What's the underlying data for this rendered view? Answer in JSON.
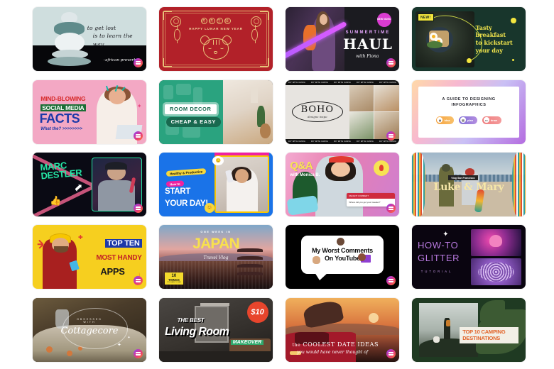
{
  "gallery": {
    "name": "youtube-thumbnail-template-gallery",
    "columns": 4,
    "rows": 5,
    "background": "#ffffff",
    "badge_icon": "canva-badge-icon",
    "cards": [
      {
        "id": "stones-proverb",
        "badge": true,
        "quote_line1": "to get lost",
        "quote_line2": "is to learn the way.",
        "attribution": "–african proverb"
      },
      {
        "id": "lunar-new-year",
        "badge": false,
        "glyphs": [
          "虎",
          "虎",
          "生",
          "威"
        ],
        "subtitle": "HAPPY LUNAR NEW YEAR"
      },
      {
        "id": "summertime-haul",
        "badge": true,
        "kicker": "SUMMERTIME",
        "title": "HAUL",
        "script": "with Fiona",
        "sticker": "NEW VIDEO"
      },
      {
        "id": "tasty-breakfast",
        "badge": false,
        "tag": "NEW!",
        "title_line1": "Tasty",
        "title_line2": "breakfast",
        "title_line3": "to kickstart",
        "title_line4": "your day"
      },
      {
        "id": "mind-blowing-facts",
        "badge": true,
        "line1": "MIND-BLOWING",
        "line2": "SOCIAL MEDIA",
        "line3": "FACTS",
        "line4": "What the? >>>>>>>>"
      },
      {
        "id": "room-decor",
        "badge": false,
        "pill1": "ROOM DECOR",
        "pill2": "CHEAP & EASY"
      },
      {
        "id": "boho",
        "badge": true,
        "strip_text": "DIY WITH CANVA",
        "title": "BOHO",
        "subtitle": "designs inspo"
      },
      {
        "id": "infographics-guide",
        "badge": false,
        "title_line1": "A GUIDE TO DESIGNING",
        "title_line2": "INFOGRAPHICS",
        "pills": [
          {
            "label": "idea",
            "icon": "bulb-icon"
          },
          {
            "label": "plan",
            "icon": "note-icon"
          },
          {
            "label": "draw",
            "icon": "screen-icon"
          }
        ]
      },
      {
        "id": "marc-destler",
        "badge": true,
        "name_line1": "MARC",
        "name_line2": "DESTLER",
        "arrow": "arrow-up-right-icon",
        "thumb": "thumbs-up-icon"
      },
      {
        "id": "start-your-day",
        "badge": false,
        "tag_top": "Healthy & Productive",
        "tag_how": "How to",
        "title_line1": "START",
        "title_line2": "YOUR DAY!"
      },
      {
        "id": "qa-monica",
        "badge": true,
        "title": "Q&A",
        "subtitle": "with Monica B.",
        "comment_header": "RECENT COMMENT",
        "comment_body": "Where did you get your sweater?"
      },
      {
        "id": "luke-and-mary",
        "badge": false,
        "tag": "Vlog San Francisco",
        "title": "Luke & Mary"
      },
      {
        "id": "top-ten-apps",
        "badge": false,
        "line1": "TOP TEN",
        "line2": "MOST HANDY",
        "line3": "APPS",
        "icon": "tap-hand-icon"
      },
      {
        "id": "japan-travel",
        "badge": false,
        "kicker": "ONE WEEK IN",
        "title": "JAPAN",
        "script": "Travel Vlog",
        "badge_num": "10",
        "badge_word": "THINGS",
        "badge_sub": "YOU HAVE TO SEE"
      },
      {
        "id": "worst-comments",
        "badge": true,
        "line1": "My Worst Comments",
        "line2": "On YouTube"
      },
      {
        "id": "how-to-glitter",
        "badge": false,
        "line1": "HOW-TO",
        "line2": "GLITTER",
        "sub": "TUTORIAL",
        "icon": "sparkle-icon"
      },
      {
        "id": "cottagecore",
        "badge": true,
        "kicker_line1": "OBSESSED",
        "kicker_line2": "WITH",
        "title": "Cottagecore"
      },
      {
        "id": "living-room-makeover",
        "badge": false,
        "line1": "THE BEST",
        "price": "$10",
        "line2": "Living Room",
        "line3": "MAKEOVER"
      },
      {
        "id": "coolest-date-ideas",
        "badge": true,
        "title_small": "the",
        "title_big": "COOLEST DATE IDEAS",
        "subtitle": "you would have never thought of"
      },
      {
        "id": "top-10-camping",
        "badge": false,
        "line1": "TOP 10 CAMPING",
        "line2": "DESTINATIONS"
      }
    ]
  }
}
